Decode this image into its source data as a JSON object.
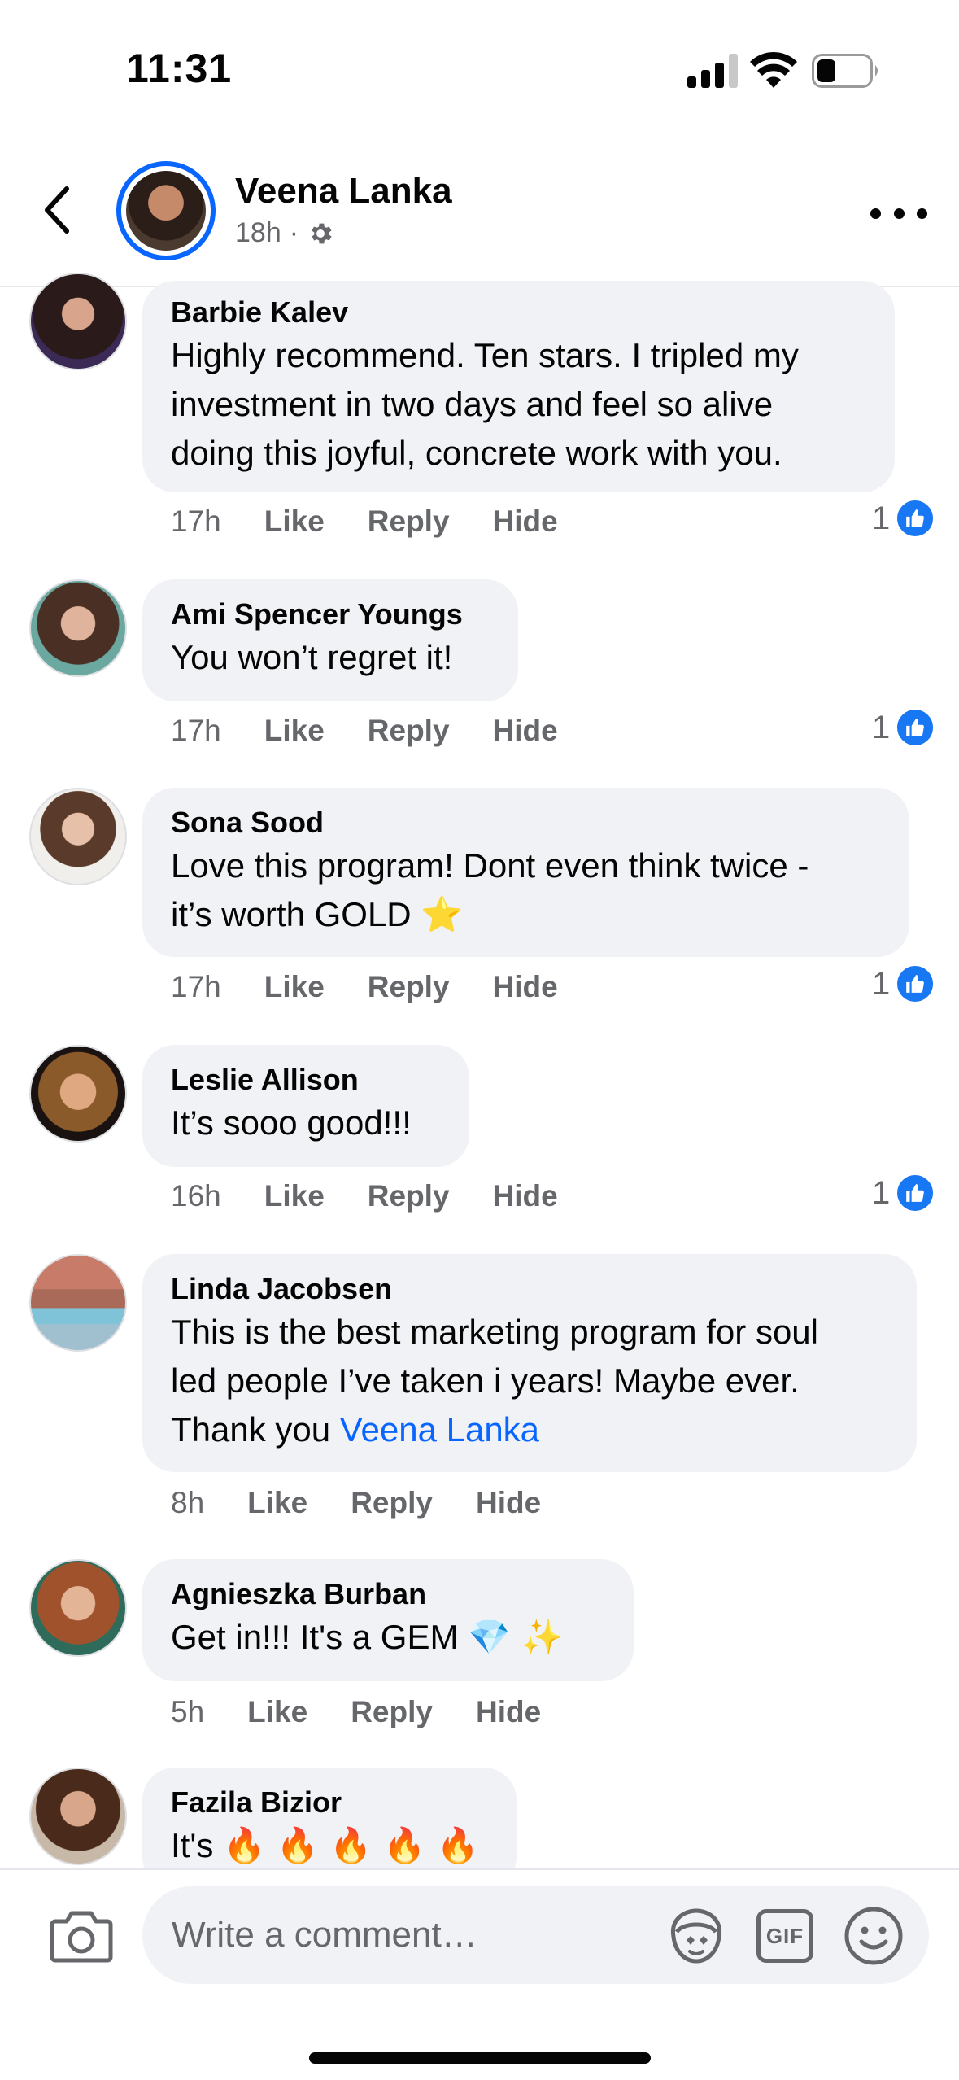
{
  "status_bar": {
    "time": "11:31"
  },
  "header": {
    "name": "Veena Lanka",
    "time": "18h",
    "separator": "·"
  },
  "comments": [
    {
      "name": "Barbie Kalev",
      "lines": [
        "Highly recommend. Ten stars. I tripled my",
        "investment in two days and feel so alive",
        "doing this joyful, concrete work with you."
      ],
      "time": "17h",
      "likes": "1"
    },
    {
      "name": "Ami Spencer Youngs",
      "lines": [
        "You won’t regret it!"
      ],
      "time": "17h",
      "likes": "1"
    },
    {
      "name": "Sona Sood",
      "lines": [
        "Love this program! Dont even think twice -",
        "it’s worth GOLD"
      ],
      "emoji": "⭐",
      "time": "17h",
      "likes": "1"
    },
    {
      "name": "Leslie Allison",
      "lines": [
        "It’s sooo good!!!"
      ],
      "time": "16h",
      "likes": "1"
    },
    {
      "name": "Linda Jacobsen",
      "lines": [
        "This is the best marketing program for soul",
        "led people I’ve taken i years! Maybe ever.",
        "Thank you"
      ],
      "mention": "Veena Lanka",
      "time": "8h"
    },
    {
      "name": "Agnieszka Burban",
      "lines": [
        "Get in!!! It's a GEM"
      ],
      "emoji": "💎 ✨",
      "time": "5h"
    },
    {
      "name": "Fazila Bizior",
      "lines": [
        "It's"
      ],
      "emoji": "🔥 🔥 🔥 🔥 🔥"
    }
  ],
  "actions": {
    "like": "Like",
    "reply": "Reply",
    "hide": "Hide"
  },
  "composer": {
    "placeholder": "Write a comment…",
    "gif_label": "GIF"
  },
  "colors": {
    "accent": "#1877f2",
    "bubble": "#f0f2f5",
    "secondary_text": "#65676b"
  },
  "icons": [
    "back-icon",
    "gear-icon",
    "more-icon",
    "like-icon",
    "camera-icon",
    "avatar-sticker-icon",
    "gif-icon",
    "smiley-icon"
  ]
}
